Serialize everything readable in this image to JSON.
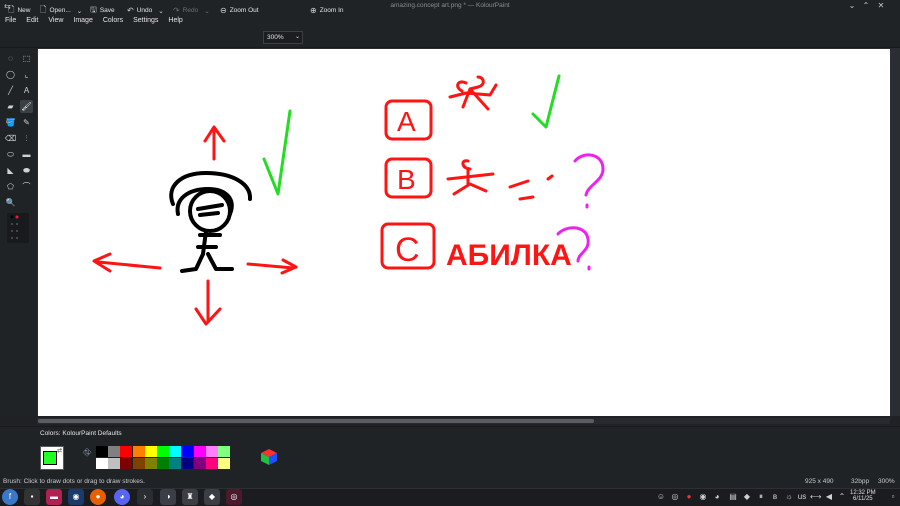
{
  "window": {
    "title": "amazing.concept art.png * — KolourPaint"
  },
  "menu": [
    "File",
    "Edit",
    "View",
    "Image",
    "Colors",
    "Settings",
    "Help"
  ],
  "toolbar": {
    "new_label": "New",
    "open_label": "Open...",
    "save_label": "Save",
    "undo_label": "Undo",
    "redo_label": "Redo",
    "zoom_out_label": "Zoom Out",
    "zoom_value": "300%",
    "zoom_in_label": "Zoom In"
  },
  "palette": {
    "title": "Colors: KolourPaint Defaults",
    "foreground_color": "#22ff22",
    "colors_row1": [
      "#000000",
      "#808080",
      "#ff0000",
      "#ff8000",
      "#ffff00",
      "#00ff00",
      "#00ffff",
      "#0000ff",
      "#ff00ff",
      "#ff80ff",
      "#80ff80"
    ],
    "colors_row2": [
      "#ffffff",
      "#c0c0c0",
      "#800000",
      "#804000",
      "#808000",
      "#008000",
      "#008080",
      "#000080",
      "#800080",
      "#ff0080",
      "#ffff80"
    ]
  },
  "drawing": {
    "options": [
      "A",
      "B",
      "C"
    ],
    "option_c_text": "АБИЛКА",
    "question_mark": "?"
  },
  "status": {
    "hint": "Brush: Click to draw dots or drag to draw strokes.",
    "dimensions": "925 x 490",
    "depth": "32bpp",
    "zoom": "300%"
  },
  "taskbar": {
    "keyboard_layout": "us",
    "time": "12:32 PM",
    "date": "6/11/25"
  }
}
